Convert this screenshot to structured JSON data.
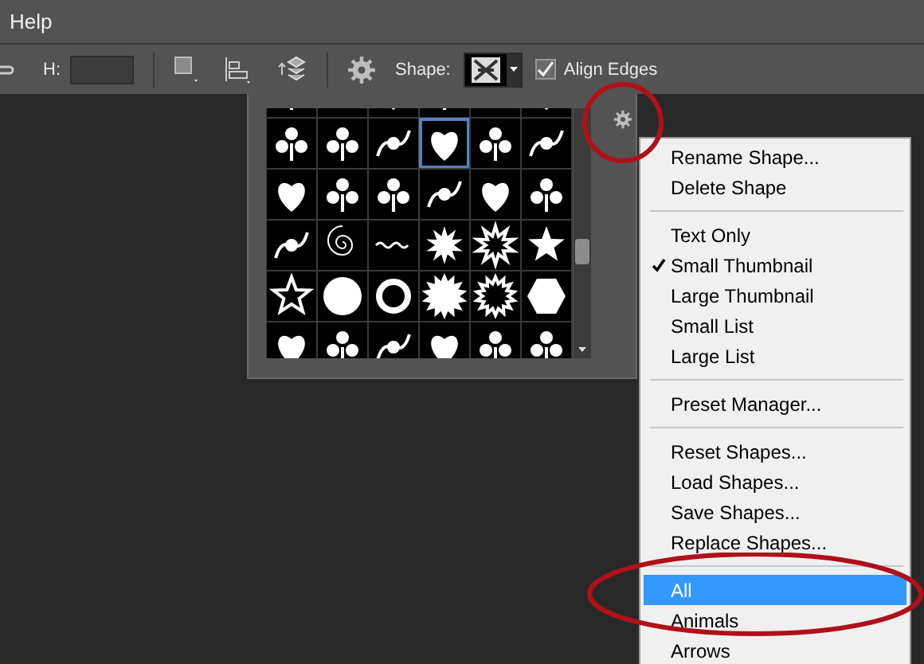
{
  "menu_bar": {
    "items": [
      "Help"
    ]
  },
  "toolbar": {
    "height_label": "H:",
    "shape_label": "Shape:",
    "align_edges": {
      "label": "Align Edges",
      "checked": true
    }
  },
  "context_menu": {
    "items": [
      {
        "kind": "item",
        "label": "Rename Shape...",
        "checked": false,
        "selected": false
      },
      {
        "kind": "item",
        "label": "Delete Shape",
        "checked": false,
        "selected": false
      },
      {
        "kind": "separator"
      },
      {
        "kind": "item",
        "label": "Text Only",
        "checked": false,
        "selected": false
      },
      {
        "kind": "item",
        "label": "Small Thumbnail",
        "checked": true,
        "selected": false
      },
      {
        "kind": "item",
        "label": "Large Thumbnail",
        "checked": false,
        "selected": false
      },
      {
        "kind": "item",
        "label": "Small List",
        "checked": false,
        "selected": false
      },
      {
        "kind": "item",
        "label": "Large List",
        "checked": false,
        "selected": false
      },
      {
        "kind": "separator"
      },
      {
        "kind": "item",
        "label": "Preset Manager...",
        "checked": false,
        "selected": false
      },
      {
        "kind": "separator"
      },
      {
        "kind": "item",
        "label": "Reset Shapes...",
        "checked": false,
        "selected": false
      },
      {
        "kind": "item",
        "label": "Load Shapes...",
        "checked": false,
        "selected": false
      },
      {
        "kind": "item",
        "label": "Save Shapes...",
        "checked": false,
        "selected": false
      },
      {
        "kind": "item",
        "label": "Replace Shapes...",
        "checked": false,
        "selected": false
      },
      {
        "kind": "separator"
      },
      {
        "kind": "item",
        "label": "All",
        "checked": false,
        "selected": true
      },
      {
        "kind": "item",
        "label": "Animals",
        "checked": false,
        "selected": false
      },
      {
        "kind": "item",
        "label": "Arrows",
        "checked": false,
        "selected": false
      }
    ]
  }
}
